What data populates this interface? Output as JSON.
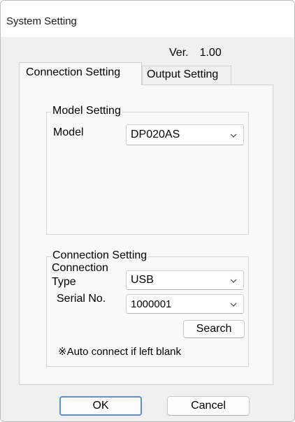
{
  "window": {
    "title": "System Setting"
  },
  "version": {
    "label": "Ver.",
    "number": "1.00"
  },
  "tabs": [
    {
      "label": "Connection Setting",
      "active": true
    },
    {
      "label": "Output Setting",
      "active": false
    }
  ],
  "model_group": {
    "legend": "Model Setting",
    "model_label": "Model",
    "model_value": "DP020AS"
  },
  "connection_group": {
    "legend": "Connection Setting",
    "type_label_line1": "Connection",
    "type_label_line2": "Type",
    "type_value": "USB",
    "serial_label": "Serial No.",
    "serial_value": "1000001",
    "search_label": "Search",
    "note": "※Auto connect if left blank"
  },
  "footer": {
    "ok_label": "OK",
    "cancel_label": "Cancel"
  },
  "icons": {
    "dropdown": "chevron-down-icon"
  },
  "colors": {
    "default_button_border": "#5b8fd6",
    "dialog_background": "#f0f0f0",
    "panel_background": "#f9f9f9"
  }
}
